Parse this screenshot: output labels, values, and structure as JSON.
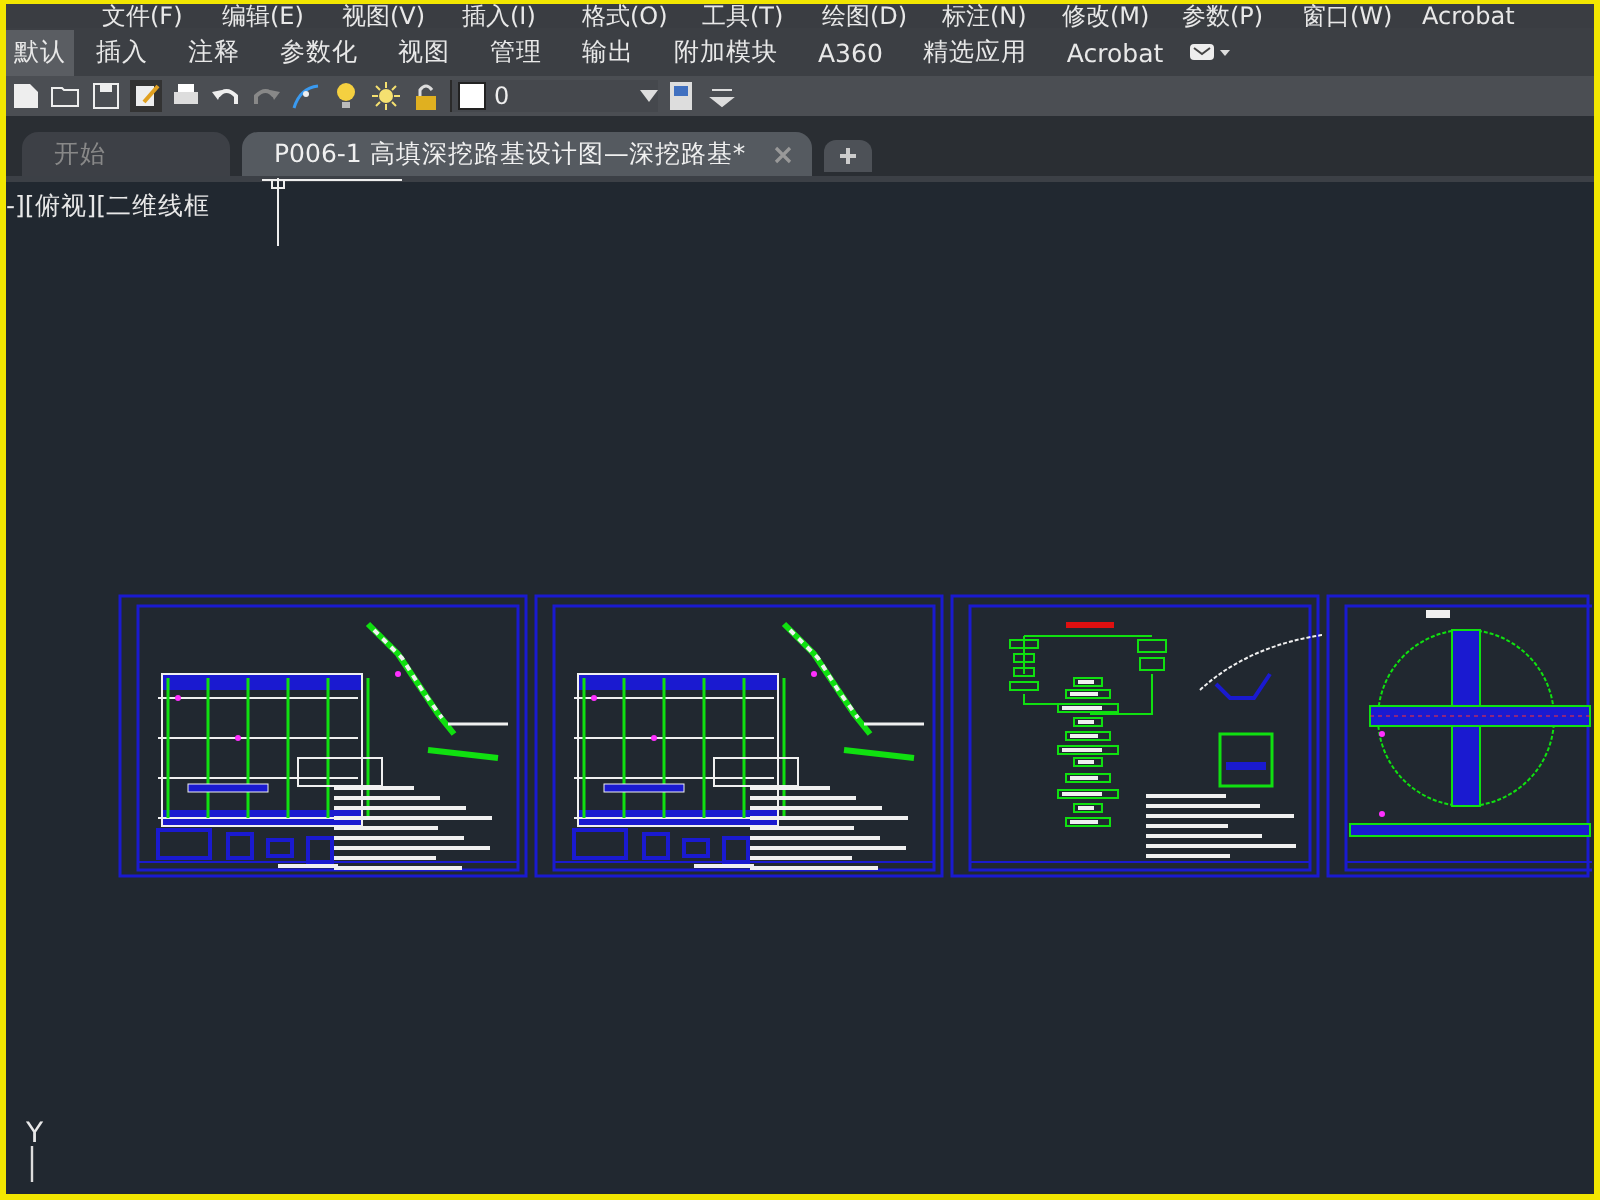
{
  "menu_bar": {
    "items": [
      "文件(F)",
      "编辑(E)",
      "视图(V)",
      "插入(I)",
      "格式(O)",
      "工具(T)",
      "绘图(D)",
      "标注(N)",
      "修改(M)",
      "参数(P)",
      "窗口(W)",
      "Acrobat"
    ]
  },
  "ribbon_tabs": [
    {
      "label": "默认",
      "selected": true
    },
    {
      "label": "插入",
      "selected": false
    },
    {
      "label": "注释",
      "selected": false
    },
    {
      "label": "参数化",
      "selected": false
    },
    {
      "label": "视图",
      "selected": false
    },
    {
      "label": "管理",
      "selected": false
    },
    {
      "label": "输出",
      "selected": false
    },
    {
      "label": "附加模块",
      "selected": false
    },
    {
      "label": "A360",
      "selected": false
    },
    {
      "label": "精选应用",
      "selected": false
    },
    {
      "label": "Acrobat",
      "selected": false
    }
  ],
  "toolbar": {
    "layer": "0"
  },
  "document_tabs": [
    {
      "label": "开始",
      "selected": false
    },
    {
      "label": "P006-1 高填深挖路基设计图—深挖路基*",
      "selected": true
    }
  ],
  "viewport": {
    "label": "-][俯视][二维线框",
    "axis": "Y"
  },
  "sheets": [
    {
      "kind": "plan"
    },
    {
      "kind": "plan"
    },
    {
      "kind": "flowchart"
    },
    {
      "kind": "circle"
    }
  ]
}
